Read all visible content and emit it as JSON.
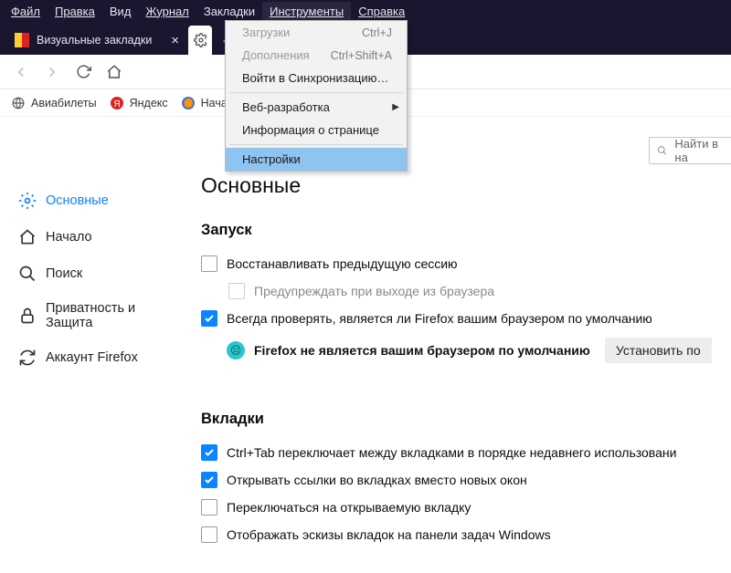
{
  "menubar": {
    "file": "Файл",
    "edit": "Правка",
    "view": "Вид",
    "history": "Журнал",
    "bookmarks": "Закладки",
    "tools": "Инструменты",
    "help": "Справка"
  },
  "tabs": {
    "tab1_label": "Визуальные закладки",
    "tab2_label": "Настройки"
  },
  "bookmarks_bar": {
    "item1": "Авиабилеты",
    "item2": "Яндекс",
    "item3": "Началь"
  },
  "dropdown": {
    "downloads": "Загрузки",
    "downloads_shortcut": "Ctrl+J",
    "addons": "Дополнения",
    "addons_shortcut": "Ctrl+Shift+A",
    "sync": "Войти в Синхронизацию…",
    "webdev": "Веб-разработка",
    "pageinfo": "Информация о странице",
    "settings": "Настройки"
  },
  "search_prefs_placeholder": "Найти в на",
  "sidebar": {
    "general": "Основные",
    "home": "Начало",
    "search": "Поиск",
    "privacy": "Приватность и Защита",
    "account": "Аккаунт Firefox"
  },
  "content": {
    "h1": "Основные",
    "startup_h": "Запуск",
    "restore_session": "Восстанавливать предыдущую сессию",
    "warn_on_quit": "Предупреждать при выходе из браузера",
    "check_default": "Всегда проверять, является ли Firefox вашим браузером по умолчанию",
    "not_default_status": "Firefox не является вашим браузером по умолчанию",
    "set_default_btn": "Установить по",
    "tabs_h": "Вкладки",
    "ctrl_tab": "Ctrl+Tab переключает между вкладками в порядке недавнего использовани",
    "open_links_tabs": "Открывать ссылки во вкладках вместо новых окон",
    "switch_to_tab": "Переключаться на открываемую вкладку",
    "taskbar_thumbs": "Отображать эскизы вкладок на панели задач Windows"
  }
}
